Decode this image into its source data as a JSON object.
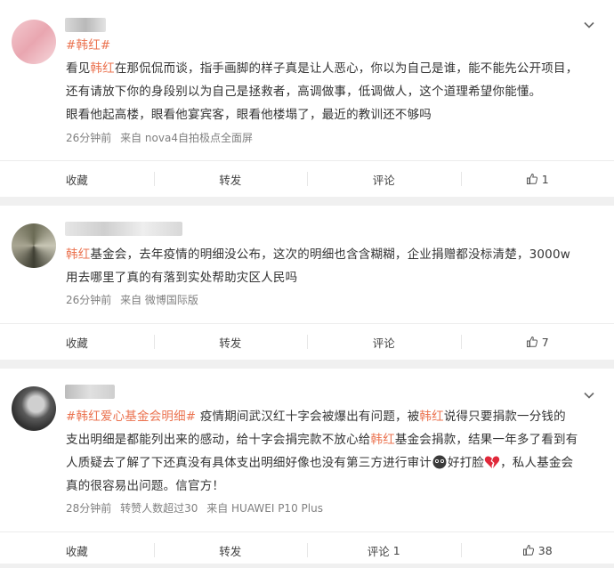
{
  "posts": [
    {
      "topic": "#韩红#",
      "lines": [
        [
          "看见",
          "韩红",
          "在那侃侃而谈，指手画脚的样子真是让人恶心，你以为自己是谁，能不能先公开项目，"
        ],
        [
          "还有请放下你的身段别以为自己是拯救者，高调做事，低调做人，这个道理希望你能懂。"
        ],
        [
          "眼看他起高楼，眼看他宴宾客，眼看他楼塌了，最近的教训还不够吗"
        ]
      ],
      "time": "26分钟前",
      "source": "来自 nova4自拍极点全面屏",
      "actions": {
        "fav": "收藏",
        "repost": "转发",
        "comment": "评论",
        "like_count": "1"
      }
    },
    {
      "lines": [
        [
          "",
          "韩红",
          "基金会，去年疫情的明细没公布，这次的明细也含含糊糊，企业捐赠都没标清楚，3000w"
        ],
        [
          "用去哪里了真的有落到实处帮助灾区人民吗"
        ]
      ],
      "time": "26分钟前",
      "source": "来自 微博国际版",
      "actions": {
        "fav": "收藏",
        "repost": "转发",
        "comment": "评论",
        "like_count": "7"
      }
    },
    {
      "topic": "#韩红爱心基金会明细#",
      "line1_rest": " 疫情期间武汉红十字会被爆出有问题，被",
      "line1_hl": "韩红",
      "line1_end": "说得只要捐款一分钱的",
      "line2_a": "支出明细是都能列出来的感动，给十字会捐完款不放心给",
      "line2_hl": "韩红",
      "line2_b": "基金会捐款，结果一年多了看到有",
      "line3_a": "人质疑去了解了下还真没有具体支出明细好像也没有第三方进行审计",
      "line3_b": "好打脸",
      "line3_c": "，私人基金会",
      "line4": "真的很容易出问题。信官方！",
      "time": "28分钟前",
      "reposters": "转赞人数超过30",
      "source": "来自 HUAWEI P10 Plus",
      "actions": {
        "fav": "收藏",
        "repost": "转发",
        "comment": "评论",
        "comment_count": "1",
        "like_count": "38"
      }
    }
  ]
}
